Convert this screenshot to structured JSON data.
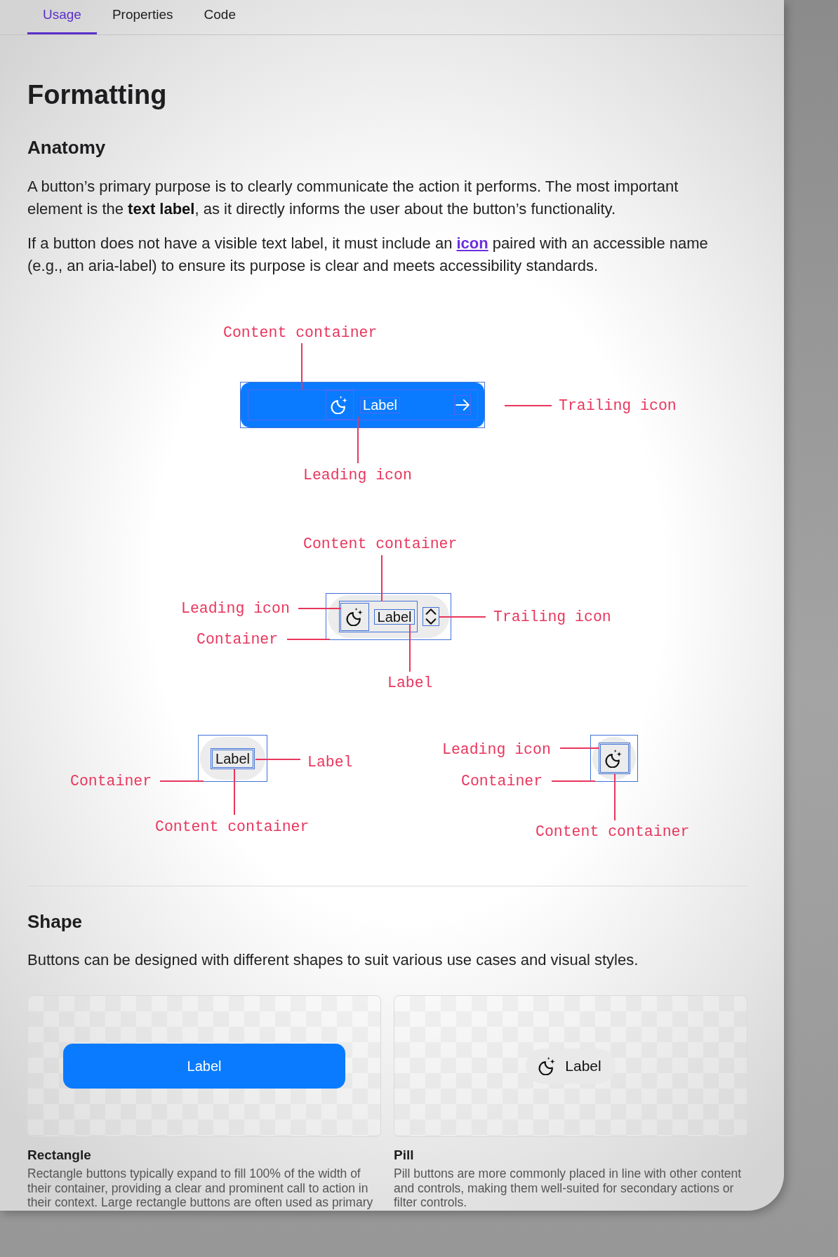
{
  "tabs": [
    {
      "label": "Usage",
      "selected": true
    },
    {
      "label": "Properties",
      "selected": false
    },
    {
      "label": "Code",
      "selected": false
    }
  ],
  "title": "Formatting",
  "anatomy": {
    "heading": "Anatomy",
    "paragraphs": [
      {
        "text": "A button’s primary purpose is to clearly communicate the action it performs. The most important element is the **text label**, as it directly informs the user about the button’s functionality."
      },
      {
        "text": "If a button does not have a visible text label, it must include an ",
        "link": "icon",
        "after": " paired with an accessible name (e.g., an aria-label) to ensure its purpose is clear and meets accessibility standards."
      }
    ]
  },
  "diagrams": [
    {
      "kind": "filled",
      "label": "Label",
      "annotations": [
        "Content container",
        "Trailing icon",
        "Leading icon"
      ]
    },
    {
      "kind": "pill",
      "label": "Label",
      "annotations": [
        "Content container",
        "Leading icon",
        "Trailing icon",
        "Container",
        "Label"
      ]
    },
    {
      "kind": "label_only",
      "label": "Label",
      "annotations": [
        "Label",
        "Container",
        "Content container"
      ]
    },
    {
      "kind": "icon_only",
      "annotations": [
        "Leading icon",
        "Container",
        "Content container"
      ]
    }
  ],
  "shape": {
    "heading": "Shape",
    "description": "Buttons can be designed with different shapes to suit various use cases and visual styles.",
    "examples": [
      {
        "kind": "rectangle",
        "button_label": "Label",
        "title": "Rectangle",
        "description": "Rectangle buttons typically expand to fill 100% of the width of their container, providing a clear and prominent call to action in their context. Large rectangle buttons are often used as primary"
      },
      {
        "kind": "pill",
        "button_label": "Label",
        "title": "Pill",
        "description": "Pill buttons are more commonly placed in line with other content and controls, making them well-suited for secondary actions or filter controls."
      }
    ]
  }
}
